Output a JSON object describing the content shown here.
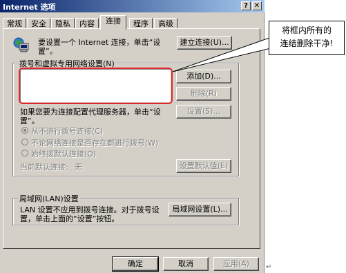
{
  "window": {
    "title": "Internet 选项",
    "help_glyph": "?",
    "close_glyph": "✕"
  },
  "tabs": [
    {
      "label": "常规"
    },
    {
      "label": "安全"
    },
    {
      "label": "隐私"
    },
    {
      "label": "内容"
    },
    {
      "label": "连接"
    },
    {
      "label": "程序"
    },
    {
      "label": "高级"
    }
  ],
  "active_tab": "连接",
  "setup": {
    "text_line1": "要设置一个 Internet 连接，单击“设",
    "text_line2": "置”。",
    "button_label": "建立连接(U)...",
    "icon": "computer-network-icon"
  },
  "dialup": {
    "group_label": "拨号和虚拟专用网络设置(N)",
    "add_button": "添加(D)...",
    "delete_button": "删除(R)",
    "proxy_text_line1": "如果您要为连接配置代理服务器，单击“设",
    "proxy_text_line2": "置”。",
    "settings_button": "设置(S)...",
    "radio_options": [
      {
        "label": "从不进行拨号连接(C)",
        "checked": true
      },
      {
        "label": "不论网络连接是否存在都进行拨号(W)",
        "checked": false
      },
      {
        "label": "始终拨默认连接(O)",
        "checked": false
      }
    ],
    "current_default_label": "当前默认连接:",
    "current_default_value": "无",
    "set_default_button": "设置默认值(E)"
  },
  "lan": {
    "group_label": "局域网(LAN)设置",
    "text_line1": "LAN 设置不应用到拨号连接。对于拨号设",
    "text_line2": "置，单击上面的“设置”按钮。",
    "button_label": "局域网设置(L)..."
  },
  "footer": {
    "ok": "确定",
    "cancel": "取消",
    "apply": "应用(A)"
  },
  "annotation": {
    "line1": "将框内所有的",
    "line2": "连结删除干净!"
  },
  "colors": {
    "title_bar": "#0a246a",
    "dialog_face": "#d4d0c8",
    "highlight_box": "#e0252b"
  }
}
